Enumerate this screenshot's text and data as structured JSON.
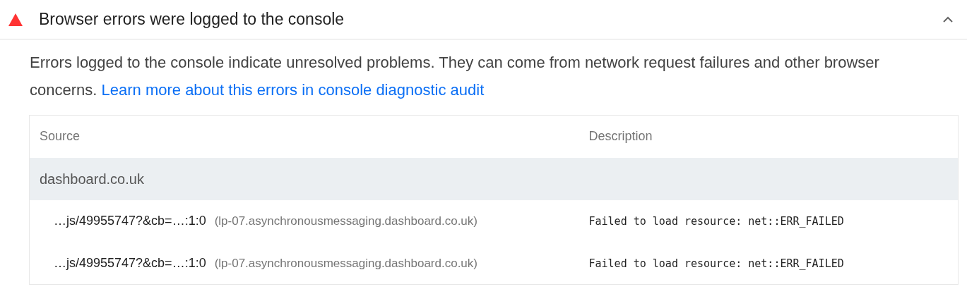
{
  "audit": {
    "title": "Browser errors were logged to the console",
    "expanded": true
  },
  "description": {
    "text": "Errors logged to the console indicate unresolved problems. They can come from network request failures and other browser concerns.",
    "link": "Learn more about this errors in console diagnostic audit"
  },
  "table": {
    "columns": [
      "Source",
      "Description"
    ],
    "groups": [
      {
        "name": "dashboard.co.uk",
        "rows": [
          {
            "source": "…js/49955747?&cb=…:1:0",
            "host": "(lp-07.asynchronousmessaging.dashboard.co.uk)",
            "description": "Failed to load resource: net::ERR_FAILED"
          },
          {
            "source": "…js/49955747?&cb=…:1:0",
            "host": "(lp-07.asynchronousmessaging.dashboard.co.uk)",
            "description": "Failed to load resource: net::ERR_FAILED"
          }
        ]
      }
    ]
  }
}
